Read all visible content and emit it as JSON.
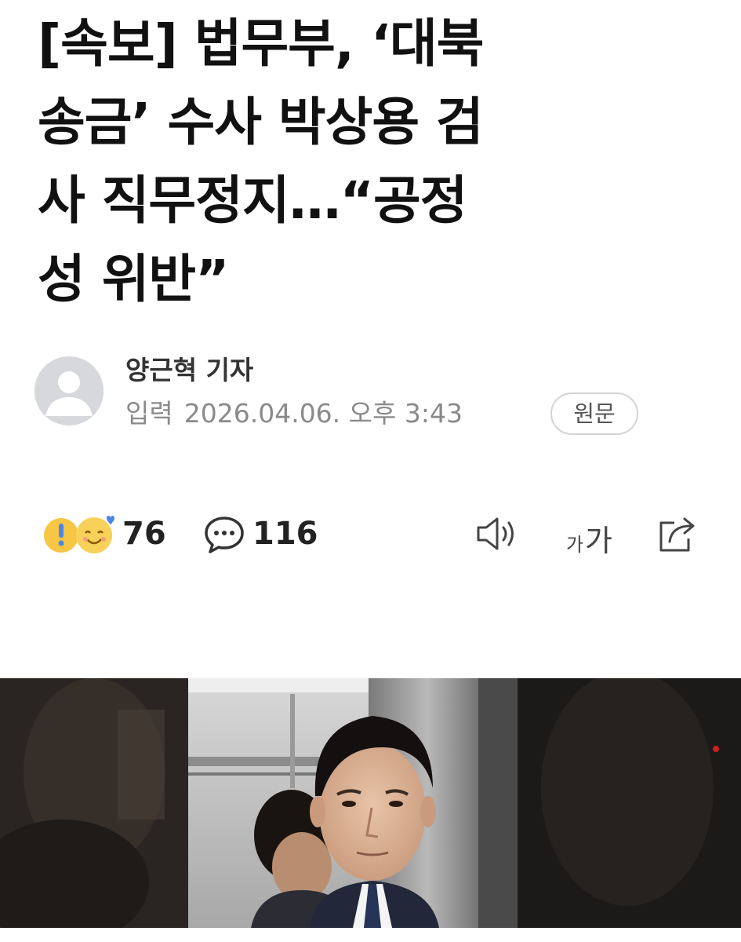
{
  "article": {
    "headline_lines": [
      "[속보] 법무부, ‘대북",
      "송금’ 수사 박상용 검",
      "사 직무정지…“공정",
      "성 위반”"
    ],
    "author": "양근혁 기자",
    "date_label": "입력",
    "date_value": "2026.04.06. 오후 3:43",
    "origin_button": "원문"
  },
  "actions": {
    "reactions_count": "76",
    "comments_count": "116",
    "font_small": "가",
    "font_big": "가"
  },
  "icons": {
    "reactions": "reaction-emoji-icons",
    "comments": "comment-bubble-icon",
    "tts": "speaker-icon",
    "font_size": "font-size-icon",
    "share": "share-icon"
  },
  "colors": {
    "headline": "#111111",
    "meta": "#8a8a8a",
    "avatar_bg": "#d6d8db",
    "reaction_yellow": "#f6c644",
    "reaction_blue": "#4a86e8"
  }
}
